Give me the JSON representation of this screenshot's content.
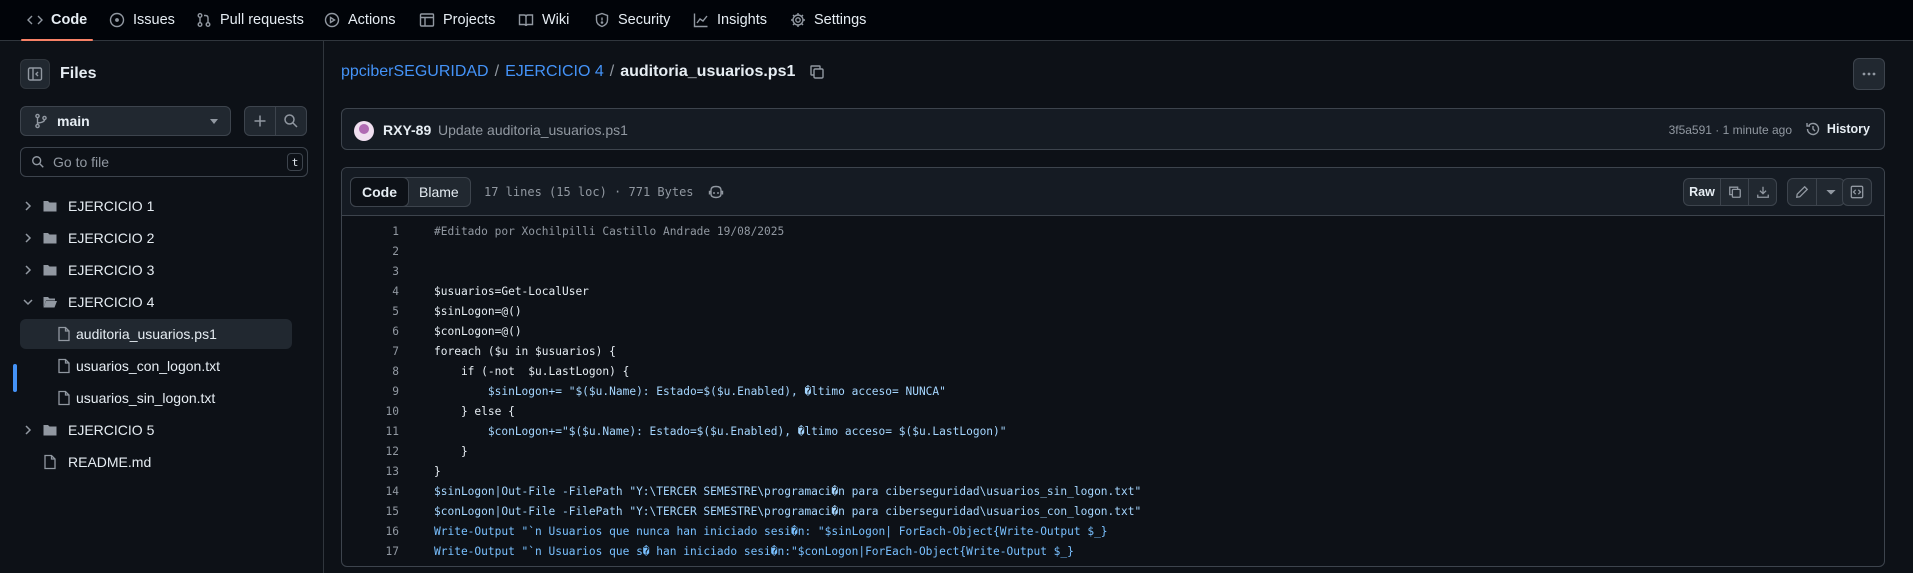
{
  "topnav": {
    "items": [
      {
        "label": "Code",
        "icon": "code-icon",
        "active": true
      },
      {
        "label": "Issues",
        "icon": "issue-icon"
      },
      {
        "label": "Pull requests",
        "icon": "pull-request-icon"
      },
      {
        "label": "Actions",
        "icon": "play-icon"
      },
      {
        "label": "Projects",
        "icon": "table-icon"
      },
      {
        "label": "Wiki",
        "icon": "book-icon"
      },
      {
        "label": "Security",
        "icon": "shield-icon"
      },
      {
        "label": "Insights",
        "icon": "graph-icon"
      },
      {
        "label": "Settings",
        "icon": "gear-icon"
      }
    ]
  },
  "sidebar": {
    "title": "Files",
    "branch": "main",
    "goto_placeholder": "Go to file",
    "goto_shortcut": "t",
    "tree": [
      {
        "label": "EJERCICIO 1",
        "type": "folder",
        "expanded": false
      },
      {
        "label": "EJERCICIO 2",
        "type": "folder",
        "expanded": false
      },
      {
        "label": "EJERCICIO 3",
        "type": "folder",
        "expanded": false
      },
      {
        "label": "EJERCICIO 4",
        "type": "folder",
        "expanded": true
      },
      {
        "label": "auditoria_usuarios.ps1",
        "type": "file",
        "selected": true
      },
      {
        "label": "usuarios_con_logon.txt",
        "type": "file"
      },
      {
        "label": "usuarios_sin_logon.txt",
        "type": "file"
      },
      {
        "label": "EJERCICIO 5",
        "type": "folder",
        "expanded": false
      },
      {
        "label": "README.md",
        "type": "file"
      }
    ]
  },
  "breadcrumb": {
    "repo": "ppciberSEGURIDAD",
    "sep": "/",
    "folder": "EJERCICIO 4",
    "file": "auditoria_usuarios.ps1"
  },
  "commit": {
    "author": "RXY-89",
    "message": "Update auditoria_usuarios.ps1",
    "meta": "3f5a591 · 1 minute ago",
    "history_label": "History"
  },
  "file": {
    "tab_code": "Code",
    "tab_blame": "Blame",
    "meta": "17 lines (15 loc) · 771 Bytes",
    "raw_label": "Raw",
    "lines": [
      "#Editado por Xochilpilli Castillo Andrade 19/08/2025",
      "",
      "",
      "$usuarios=Get-LocalUser",
      "$sinLogon=@()",
      "$conLogon=@()",
      "foreach ($u in $usuarios) {",
      "    if (-not  $u.LastLogon) {",
      "        $sinLogon+= \"$($u.Name): Estado=$($u.Enabled), �ltimo acceso= NUNCA\"",
      "    } else {",
      "        $conLogon+=\"$($u.Name): Estado=$($u.Enabled), �ltimo acceso= $($u.LastLogon)\"",
      "    }",
      "}",
      "$sinLogon|Out-File -FilePath \"Y:\\TERCER SEMESTRE\\programaci�n para ciberseguridad\\usuarios_sin_logon.txt\"",
      "$conLogon|Out-File -FilePath \"Y:\\TERCER SEMESTRE\\programaci�n para ciberseguridad\\usuarios_con_logon.txt\"",
      "Write-Output \"`n Usuarios que nunca han iniciado sesi�n: \"$sinLogon| ForEach-Object{Write-Output $_}",
      "Write-Output \"`n Usuarios que s� han iniciado sesi�n:\"$conLogon|ForEach-Object{Write-Output $_}"
    ]
  },
  "colors": {
    "accent": "#4493f8",
    "tab_underline": "#f78166",
    "background": "#0d1117"
  }
}
